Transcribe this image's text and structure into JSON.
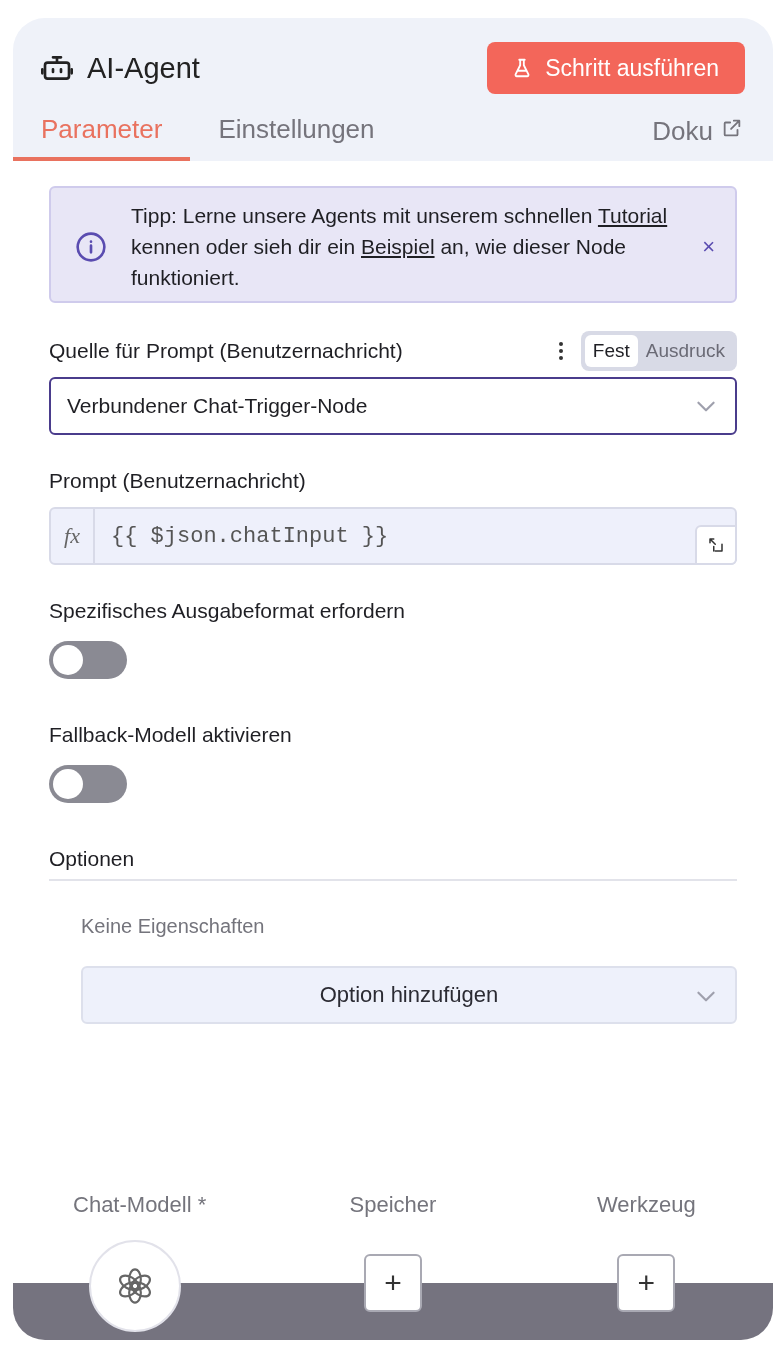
{
  "header": {
    "title": "AI-Agent",
    "run_button": "Schritt ausführen"
  },
  "tabs": [
    {
      "label": "Parameter",
      "selected": true
    },
    {
      "label": "Einstellungen",
      "selected": false
    }
  ],
  "docs_link": "Doku",
  "tip": {
    "segments": [
      {
        "kind": "text",
        "text": "Tipp: Lerne unsere Agents mit unserem schnellen "
      },
      {
        "kind": "link",
        "text": "Tutorial"
      },
      {
        "kind": "text",
        "text": " kennen oder sieh dir ein "
      },
      {
        "kind": "link",
        "text": "Beispiel"
      },
      {
        "kind": "text",
        "text": " an, wie dieser Node funktioniert."
      }
    ],
    "close": "×"
  },
  "fields": [
    {
      "kind": "select",
      "label": "Quelle für Prompt (Benutzernachricht)",
      "mode_toggle": [
        {
          "label": "Fest",
          "selected": true
        },
        {
          "label": "Ausdruck",
          "selected": false
        }
      ],
      "value": "Verbundener Chat-Trigger-Node"
    },
    {
      "kind": "expression",
      "label": "Prompt (Benutzernachricht)",
      "prefix": "fx",
      "value": "{{ $json.chatInput }}"
    },
    {
      "kind": "toggle",
      "label": "Spezifisches Ausgabeformat erfordern",
      "on": false
    },
    {
      "kind": "toggle",
      "label": "Fallback-Modell aktivieren",
      "on": false
    }
  ],
  "options": {
    "title": "Optionen",
    "empty_text": "Keine Eigenschaften",
    "add_button": "Option hinzufügen"
  },
  "connectors": [
    {
      "kind": "model",
      "label": "Chat-Modell *"
    },
    {
      "kind": "add",
      "label": "Speicher",
      "button": "+"
    },
    {
      "kind": "add",
      "label": "Werkzeug",
      "button": "+"
    }
  ]
}
